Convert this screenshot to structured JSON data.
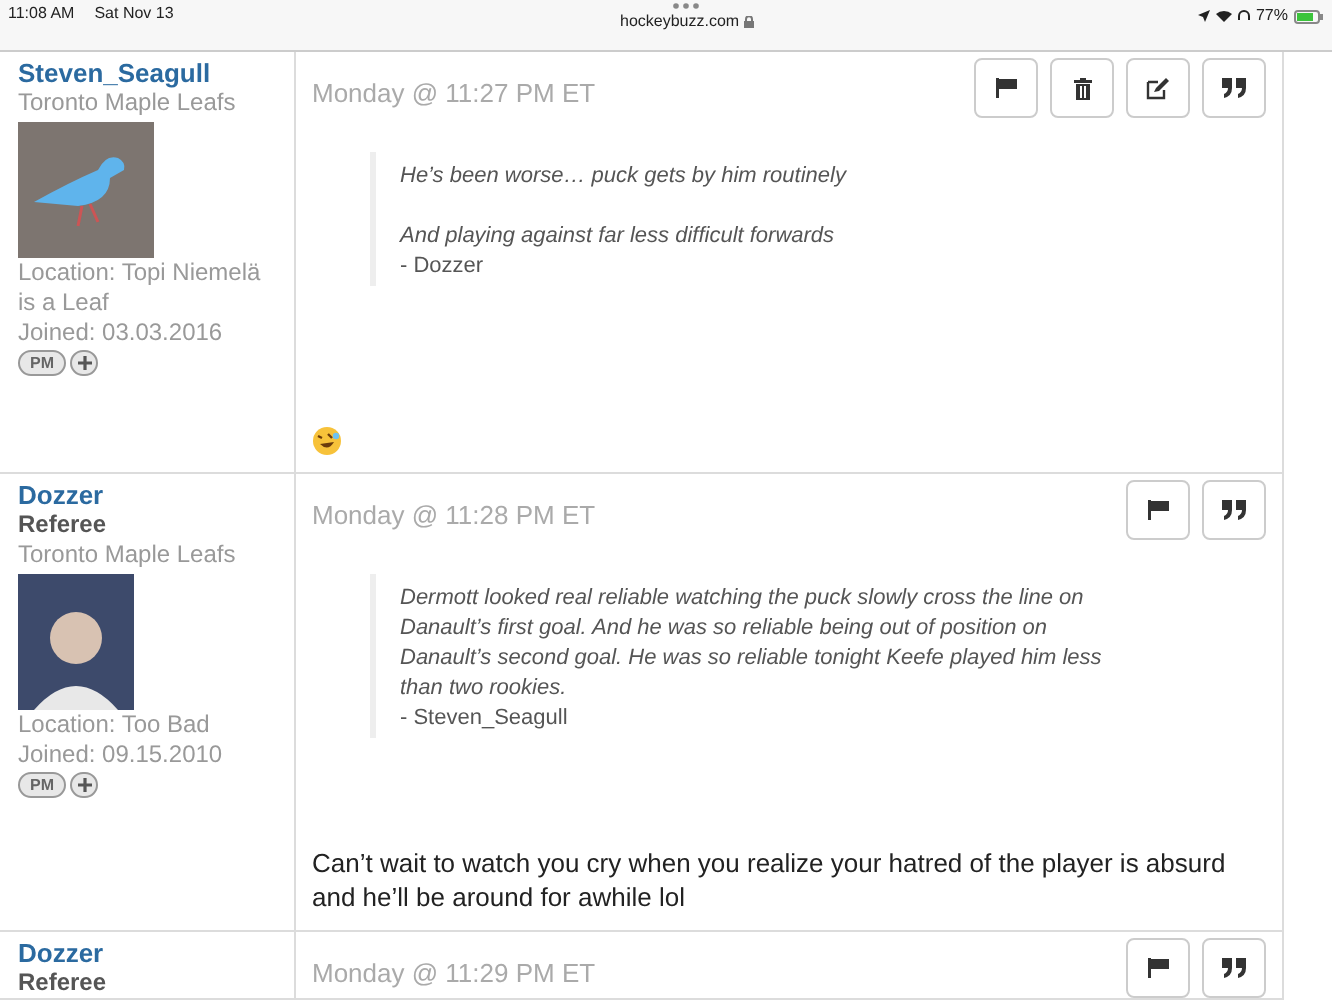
{
  "status_bar": {
    "time": "11:08 AM",
    "date": "Sat Nov 13",
    "url": "hockeybuzz.com",
    "battery": "77%"
  },
  "posts": [
    {
      "author": {
        "name": "Steven_Seagull",
        "team": "Toronto Maple Leafs",
        "avatar": {
          "kind": "bird"
        },
        "location": "Location: Topi Niemelä is a Leaf",
        "joined": "Joined: 03.03.2016",
        "pm": "PM"
      },
      "timestamp": "Monday @ 11:27 PM ET",
      "buttons": [
        {
          "kind": "flag"
        },
        {
          "kind": "delete"
        },
        {
          "kind": "edit"
        },
        {
          "kind": "quote"
        }
      ],
      "quote": {
        "lines": [
          "He’s been worse… puck gets by him routinely",
          "And playing against far less difficult forwards"
        ],
        "source": "- Dozzer"
      },
      "body": {
        "kind": "emoji"
      }
    },
    {
      "author": {
        "name": "Dozzer",
        "rank": "Referee",
        "team": "Toronto Maple Leafs",
        "avatar": {
          "kind": "person"
        },
        "location": "Location: Too Bad",
        "joined": "Joined: 09.15.2010",
        "pm": "PM"
      },
      "timestamp": "Monday @ 11:28 PM ET",
      "buttons": [
        {
          "kind": "flag"
        },
        {
          "kind": "quote"
        }
      ],
      "quote": {
        "lines": [
          "Dermott looked real reliable watching the puck slowly cross the line on Danault’s first goal. And he was so reliable being out of position on Danault’s second goal. He was so reliable tonight Keefe played him less than two rookies."
        ],
        "source": "- Steven_Seagull"
      },
      "body": {
        "kind": "text",
        "text": "Can’t wait to watch you cry when you realize your hatred of the player is absurd and he’ll be around for awhile lol"
      }
    },
    {
      "author": {
        "name": "Dozzer",
        "rank": "Referee"
      },
      "timestamp": "Monday @ 11:29 PM ET",
      "buttons": [
        {
          "kind": "flag"
        },
        {
          "kind": "quote"
        }
      ]
    }
  ]
}
